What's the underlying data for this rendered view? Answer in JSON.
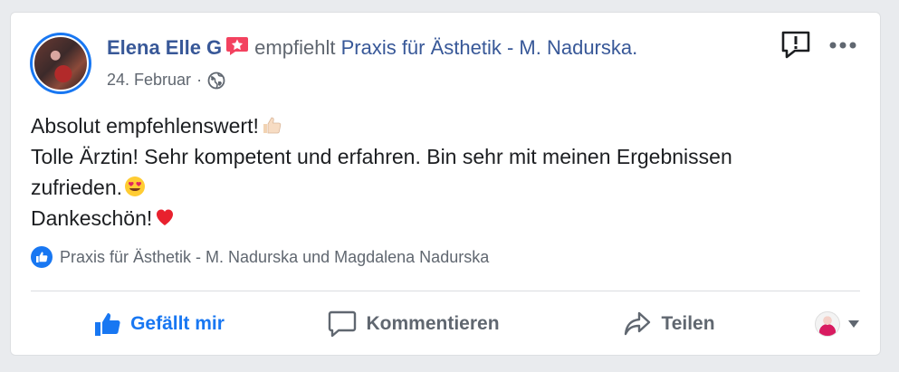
{
  "post": {
    "author": "Elena Elle G",
    "action_text": "empfiehlt",
    "page_name": "Praxis für Ästhetik - M. Nadurska.",
    "date": "24. Februar",
    "separator": "·",
    "privacy_icon": "globe-icon",
    "recommend_icon": "recommend-star-icon",
    "body_lines": [
      "Absolut empfehlenswert!",
      "Tolle Ärztin! Sehr kompetent und erfahren. Bin sehr mit meinen Ergebnissen",
      "zufrieden.",
      "Dankeschön!"
    ],
    "body_emojis": [
      "thumbs-up-emoji",
      "heart-eyes-emoji",
      "red-heart-emoji"
    ]
  },
  "reactions": {
    "icon": "like-reaction-icon",
    "text": "Praxis für Ästhetik - M. Nadurska und Magdalena Nadurska"
  },
  "actions": {
    "like_label": "Gefällt mir",
    "comment_label": "Kommentieren",
    "share_label": "Teilen"
  },
  "colors": {
    "accent": "#1877f2",
    "link": "#385898",
    "text": "#1c1e21",
    "secondary": "#606770",
    "recommend_badge": "#f3425f"
  }
}
